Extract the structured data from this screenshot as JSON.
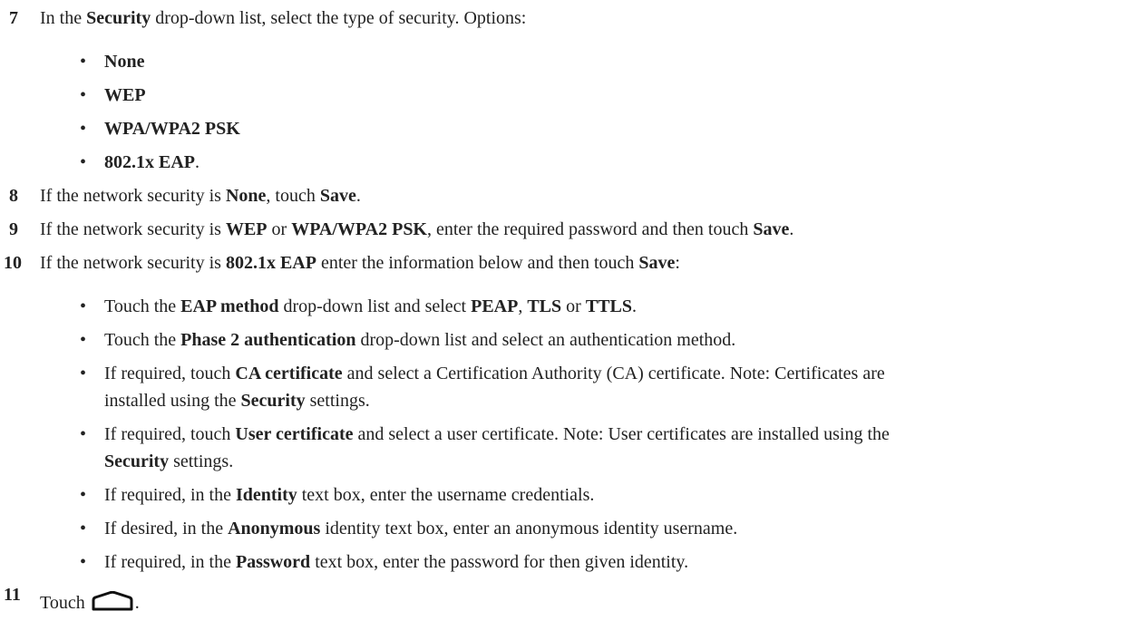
{
  "steps": {
    "s7": {
      "num": "7",
      "t1": "In the ",
      "b1": "Security",
      "t2": " drop-down list, select the type of security. Options:",
      "options": [
        "None",
        "WEP",
        "WPA/WPA2 PSK",
        "802.1x EAP"
      ],
      "last_suffix": "."
    },
    "s8": {
      "num": "8",
      "t1": "If the network security is ",
      "b1": "None",
      "t2": ", touch ",
      "b2": "Save",
      "t3": "."
    },
    "s9": {
      "num": "9",
      "t1": "If the network security is ",
      "b1": "WEP",
      "t2": " or ",
      "b2": "WPA/WPA2 PSK",
      "t3": ", enter the required password and then touch ",
      "b3": "Save",
      "t4": "."
    },
    "s10": {
      "num": "10",
      "t1": "If the network security is ",
      "b1": "802.1x EAP",
      "t2": " enter the information below and then touch ",
      "b2": "Save",
      "t3": ":",
      "items": [
        {
          "t1": "Touch the ",
          "b1": "EAP method",
          "t2": " drop-down list and select ",
          "b2": "PEAP",
          "t3": ", ",
          "b3": "TLS",
          "t4": " or ",
          "b4": "TTLS",
          "t5": "."
        },
        {
          "t1": "Touch the ",
          "b1": "Phase 2 authentication",
          "t2": " drop-down list and select an authentication method."
        },
        {
          "t1": "If required, touch ",
          "b1": "CA certificate",
          "t2": " and select a Certification Authority (CA) certificate. Note: Certificates are",
          "l2t1": "installed using the ",
          "l2b1": "Security",
          "l2t2": " settings."
        },
        {
          "t1": "If required, touch ",
          "b1": "User certificate",
          "t2": " and select a user certificate. Note: User certificates are installed using the",
          "l2b1": "Security",
          "l2t2": " settings."
        },
        {
          "t1": "If required, in the ",
          "b1": "Identity",
          "t2": " text box, enter the username credentials."
        },
        {
          "t1": "If desired, in the ",
          "b1": "Anonymous",
          "t2": " identity text box, enter an anonymous identity username."
        },
        {
          "t1": "If required, in the ",
          "b1": "Password",
          "t2": " text box, enter the password for then given identity."
        }
      ]
    },
    "s11": {
      "num": "11",
      "t1": "Touch",
      "icon": "home-icon",
      "t2": "."
    }
  }
}
